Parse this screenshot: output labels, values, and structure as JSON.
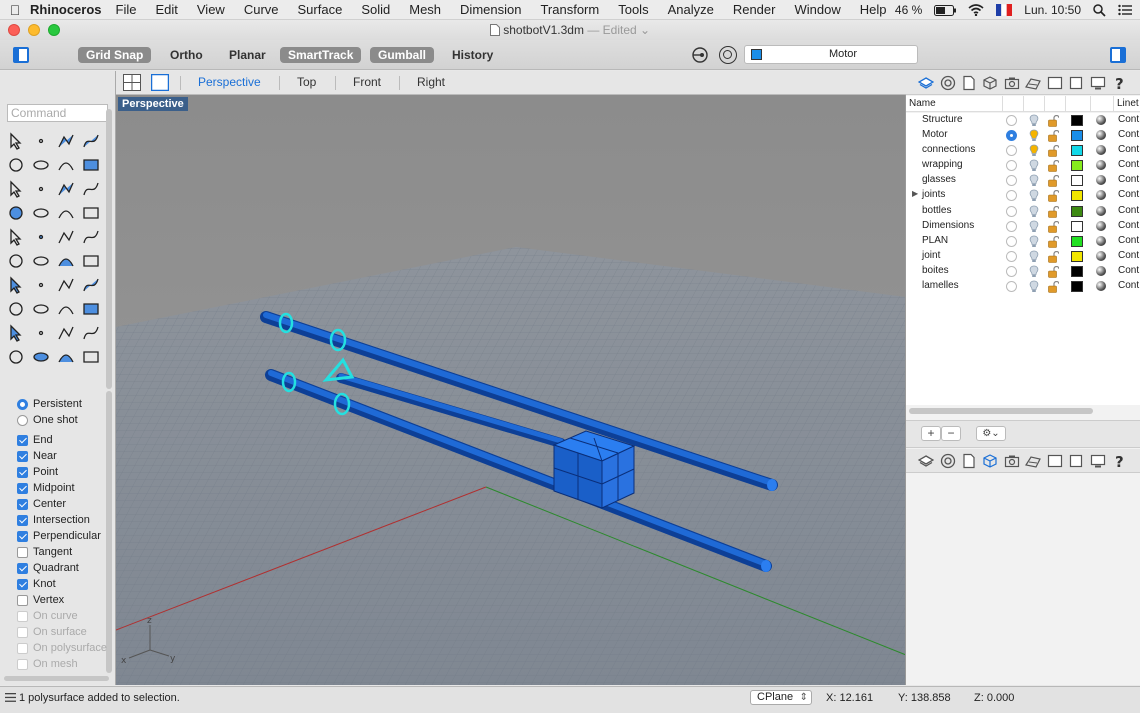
{
  "menubar": {
    "app_name": "Rhinoceros",
    "items": [
      "File",
      "Edit",
      "View",
      "Curve",
      "Surface",
      "Solid",
      "Mesh",
      "Dimension",
      "Transform",
      "Tools",
      "Analyze",
      "Render",
      "Window",
      "Help"
    ],
    "battery": "46 %",
    "clock": "Lun. 10:50"
  },
  "window": {
    "title": "shotbotV1.3dm",
    "title_suffix": "— Edited"
  },
  "toolbar": {
    "grid_snap": "Grid Snap",
    "ortho": "Ortho",
    "planar": "Planar",
    "smarttrack": "SmartTrack",
    "gumball": "Gumball",
    "history": "History",
    "current_layer": "Motor",
    "current_layer_color": "#1b8ee8"
  },
  "command": {
    "placeholder": "Command"
  },
  "osnap": {
    "persistent": "Persistent",
    "one_shot": "One shot",
    "items": [
      {
        "label": "End",
        "checked": true,
        "enabled": true
      },
      {
        "label": "Near",
        "checked": true,
        "enabled": true
      },
      {
        "label": "Point",
        "checked": true,
        "enabled": true
      },
      {
        "label": "Midpoint",
        "checked": true,
        "enabled": true
      },
      {
        "label": "Center",
        "checked": true,
        "enabled": true
      },
      {
        "label": "Intersection",
        "checked": true,
        "enabled": true
      },
      {
        "label": "Perpendicular",
        "checked": true,
        "enabled": true
      },
      {
        "label": "Tangent",
        "checked": false,
        "enabled": true
      },
      {
        "label": "Quadrant",
        "checked": true,
        "enabled": true
      },
      {
        "label": "Knot",
        "checked": true,
        "enabled": true
      },
      {
        "label": "Vertex",
        "checked": false,
        "enabled": true
      },
      {
        "label": "On curve",
        "checked": false,
        "enabled": false
      },
      {
        "label": "On surface",
        "checked": false,
        "enabled": false
      },
      {
        "label": "On polysurface",
        "checked": false,
        "enabled": false
      },
      {
        "label": "On mesh",
        "checked": false,
        "enabled": false
      }
    ]
  },
  "viewport_tabs": {
    "perspective": "Perspective",
    "top": "Top",
    "front": "Front",
    "right": "Right"
  },
  "viewport": {
    "label": "Perspective",
    "axis_z": "z",
    "axis_x": "x",
    "axis_y": "y"
  },
  "layers": {
    "name_header": "Name",
    "linetype_header": "Linet",
    "rows": [
      {
        "name": "Structure",
        "color": "#000000",
        "current": false,
        "bulb_on": false,
        "has_children": false,
        "linetype": "Cont"
      },
      {
        "name": "Motor",
        "color": "#1b8ee8",
        "current": true,
        "bulb_on": true,
        "has_children": false,
        "linetype": "Cont"
      },
      {
        "name": "connections",
        "color": "#12d8e8",
        "current": false,
        "bulb_on": true,
        "has_children": false,
        "linetype": "Cont"
      },
      {
        "name": "wrapping",
        "color": "#86ec1e",
        "current": false,
        "bulb_on": false,
        "has_children": false,
        "linetype": "Cont"
      },
      {
        "name": "glasses",
        "color": "#ffffff",
        "current": false,
        "bulb_on": false,
        "has_children": false,
        "linetype": "Cont"
      },
      {
        "name": "joints",
        "color": "#f2e600",
        "current": false,
        "bulb_on": false,
        "has_children": true,
        "linetype": "Cont"
      },
      {
        "name": "bottles",
        "color": "#3d8a12",
        "current": false,
        "bulb_on": false,
        "has_children": false,
        "linetype": "Cont"
      },
      {
        "name": "Dimensions",
        "color": "#ffffff",
        "current": false,
        "bulb_on": false,
        "has_children": false,
        "linetype": "Cont"
      },
      {
        "name": "PLAN",
        "color": "#22e022",
        "current": false,
        "bulb_on": false,
        "has_children": false,
        "linetype": "Cont"
      },
      {
        "name": "joint",
        "color": "#f2e600",
        "current": false,
        "bulb_on": false,
        "has_children": false,
        "linetype": "Cont"
      },
      {
        "name": "boites",
        "color": "#000000",
        "current": false,
        "bulb_on": false,
        "has_children": false,
        "linetype": "Cont"
      },
      {
        "name": "lamelles",
        "color": "#000000",
        "current": false,
        "bulb_on": false,
        "has_children": false,
        "linetype": "Cont"
      }
    ]
  },
  "layer_buttons": {
    "add": "+",
    "remove": "−",
    "gear": "⚙︎⌄"
  },
  "status": {
    "message": "1 polysurface added to selection.",
    "cplane": "CPlane",
    "x": "X: 12.161",
    "y": "Y: 138.858",
    "z": "Z: 0.000"
  }
}
